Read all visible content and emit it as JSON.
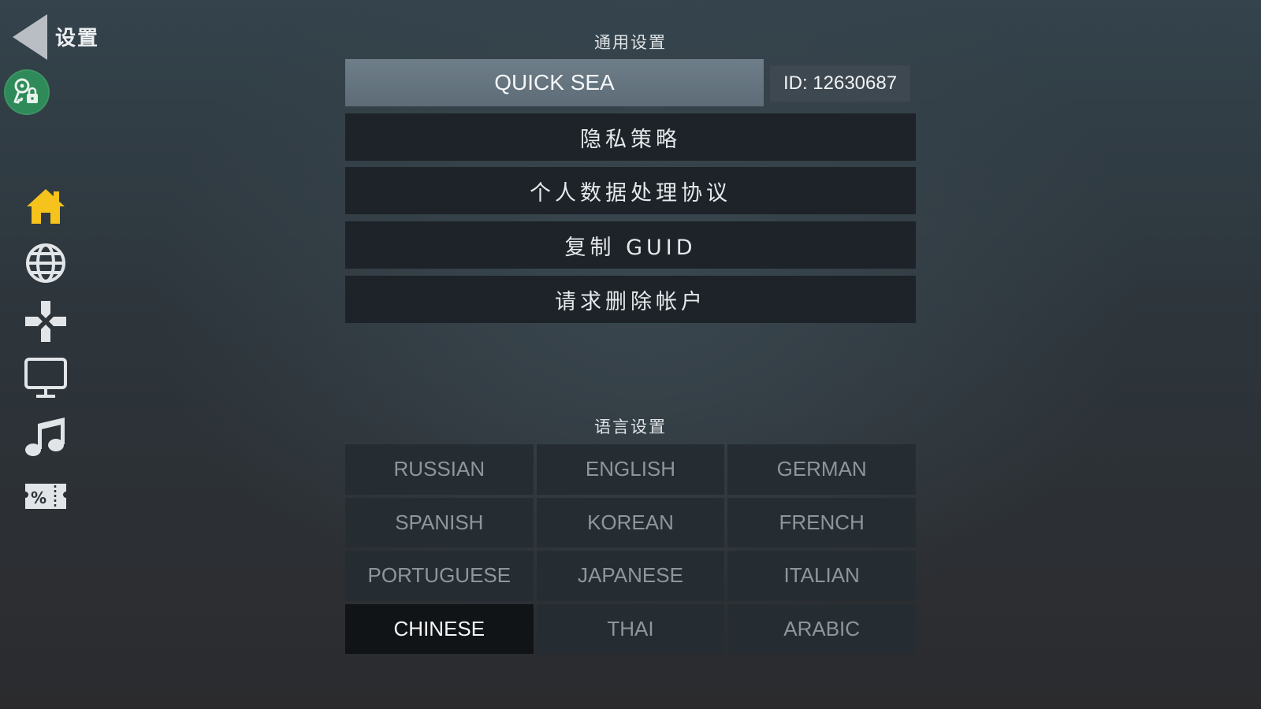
{
  "header": {
    "title": "设置",
    "back_icon": "back-arrow-icon",
    "account_icon": "key-lock-icon"
  },
  "sidebar": {
    "items": [
      {
        "name": "home",
        "icon": "home-icon",
        "color": "#f6c21c"
      },
      {
        "name": "globe",
        "icon": "globe-icon",
        "color": "#e2e5e8"
      },
      {
        "name": "controls",
        "icon": "dpad-icon",
        "color": "#e2e5e8"
      },
      {
        "name": "display",
        "icon": "monitor-icon",
        "color": "#e2e5e8"
      },
      {
        "name": "music",
        "icon": "music-note-icon",
        "color": "#e2e5e8"
      },
      {
        "name": "coupon",
        "icon": "coupon-icon",
        "color": "#e2e5e8"
      }
    ]
  },
  "general": {
    "title": "通用设置",
    "profile_name": "QUICK SEA",
    "profile_id": "ID: 12630687",
    "buttons": [
      {
        "label": "隐私策略"
      },
      {
        "label": "个人数据处理协议"
      },
      {
        "label": "复制 GUID"
      },
      {
        "label": "请求删除帐户"
      }
    ]
  },
  "language": {
    "title": "语言设置",
    "selected": "CHINESE",
    "options": [
      "RUSSIAN",
      "ENGLISH",
      "GERMAN",
      "SPANISH",
      "KOREAN",
      "FRENCH",
      "PORTUGUESE",
      "JAPANESE",
      "ITALIAN",
      "CHINESE",
      "THAI",
      "ARABIC"
    ]
  },
  "colors": {
    "accent_green": "#2e8a58",
    "home_yellow": "#f6c21c",
    "profile_bar": "#6e7e89",
    "button_dark": "#1d2328",
    "lang_selected": "#111417"
  }
}
